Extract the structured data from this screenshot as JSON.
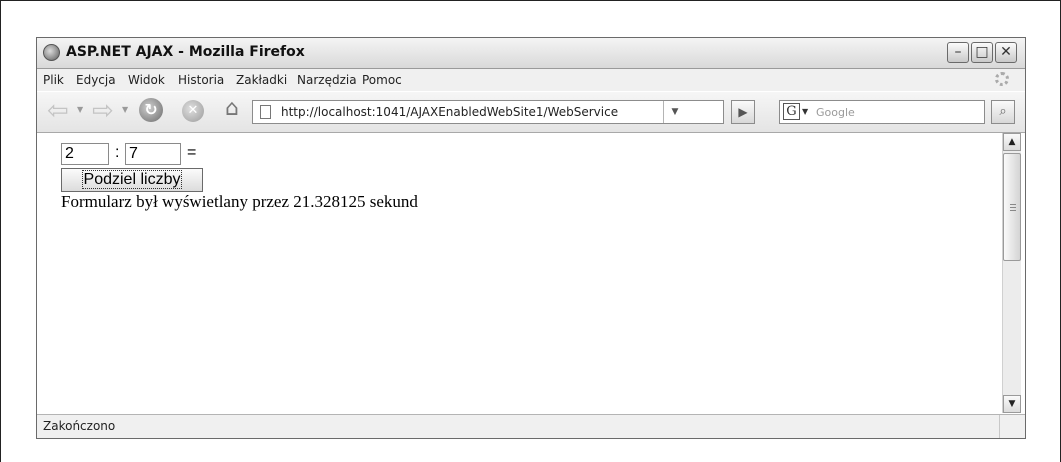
{
  "window": {
    "title": "ASP.NET AJAX - Mozilla Firefox",
    "controls": {
      "minimize": "–",
      "maximize": "□",
      "close": "✕"
    }
  },
  "menu": {
    "items": [
      "Plik",
      "Edycja",
      "Widok",
      "Historia",
      "Zakładki",
      "Narzędzia",
      "Pomoc"
    ]
  },
  "toolbar": {
    "back_icon": "back-arrow-icon",
    "forward_icon": "forward-arrow-icon",
    "reload_icon": "reload-icon",
    "stop_icon": "stop-icon",
    "home_icon": "home-icon",
    "url": "http://localhost:1041/AJAXEnabledWebSite1/WebService",
    "search_engine": "G",
    "search_placeholder": "Google"
  },
  "page": {
    "dividend": "2",
    "separator": ":",
    "divisor": "7",
    "equals": "=",
    "button_label": "Podziel liczby",
    "result_text": "Formularz był wyświetlany przez 21.328125 sekund"
  },
  "status": {
    "text": "Zakończono"
  },
  "colors": {
    "chrome_bg": "#f0f0f0",
    "border": "#6a6a6a",
    "content_bg": "#ffffff"
  }
}
